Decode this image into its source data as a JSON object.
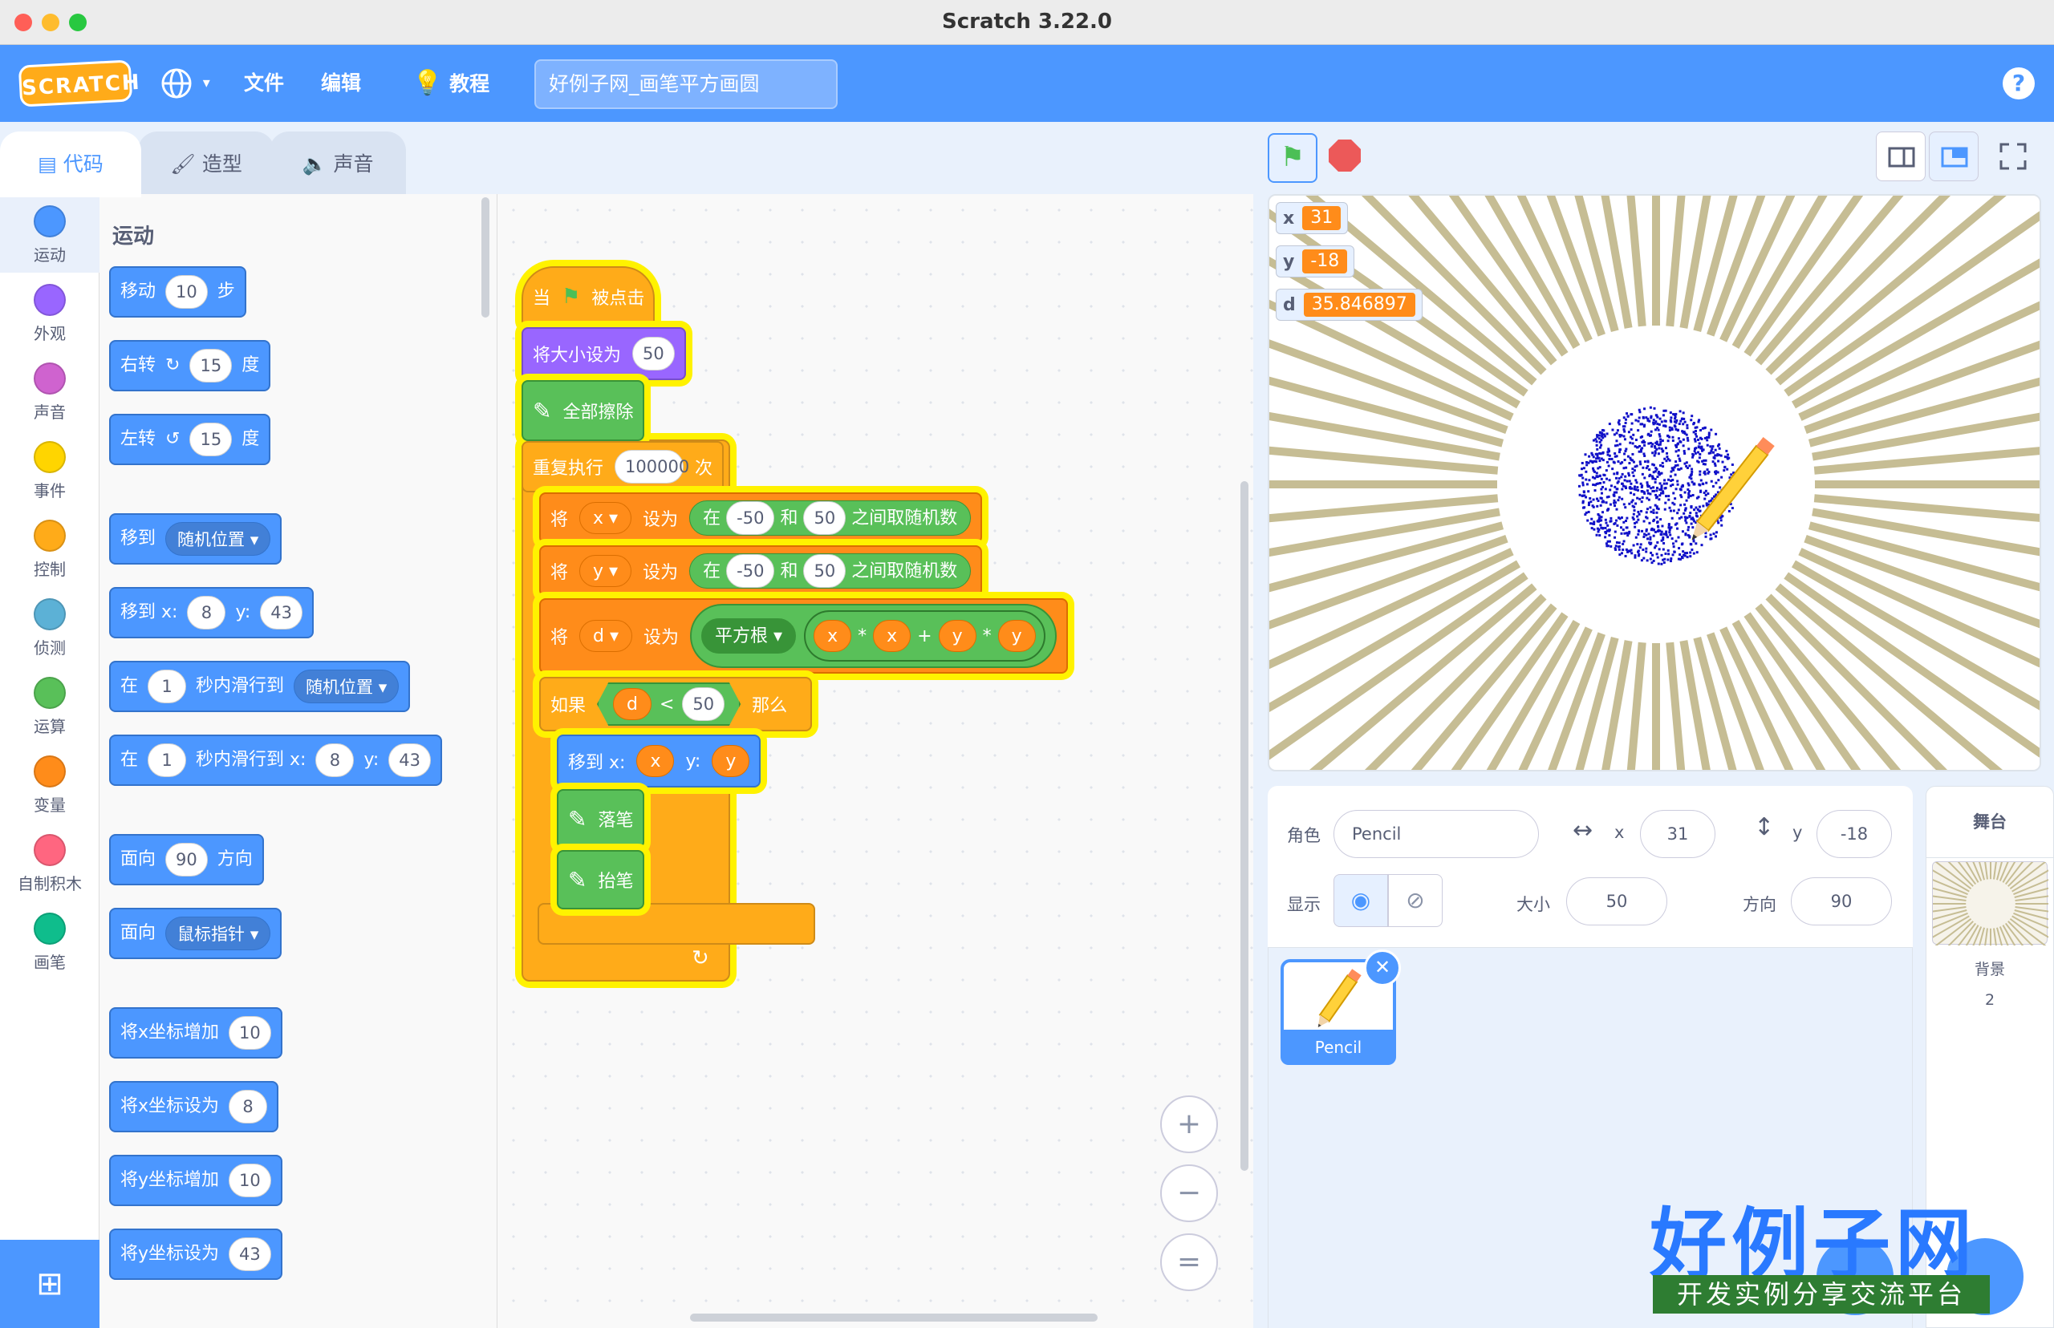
{
  "window": {
    "title": "Scratch 3.22.0"
  },
  "menubar": {
    "logo": "SCRATCH",
    "file": "文件",
    "edit": "编辑",
    "tutorials": "教程",
    "project_title": "好例子网_画笔平方画圆",
    "help": "?"
  },
  "tabs": {
    "code": "代码",
    "costumes": "造型",
    "sounds": "声音"
  },
  "categories": [
    {
      "label": "运动",
      "color": "#4c97ff"
    },
    {
      "label": "外观",
      "color": "#9966ff"
    },
    {
      "label": "声音",
      "color": "#cf63cf"
    },
    {
      "label": "事件",
      "color": "#ffd500"
    },
    {
      "label": "控制",
      "color": "#ffab19"
    },
    {
      "label": "侦测",
      "color": "#5cb1d6"
    },
    {
      "label": "运算",
      "color": "#59c059"
    },
    {
      "label": "变量",
      "color": "#ff8c1a"
    },
    {
      "label": "自制积木",
      "color": "#ff6680"
    },
    {
      "label": "画笔",
      "color": "#0fbd8c"
    }
  ],
  "palette": {
    "heading": "运动",
    "move": {
      "a": "移动",
      "v": "10",
      "b": "步"
    },
    "turn_right": {
      "a": "右转",
      "v": "15",
      "b": "度"
    },
    "turn_left": {
      "a": "左转",
      "v": "15",
      "b": "度"
    },
    "goto": {
      "a": "移到",
      "dd": "随机位置"
    },
    "goto_xy": {
      "a": "移到 x:",
      "x": "8",
      "b": "y:",
      "y": "43"
    },
    "glide_to": {
      "a": "在",
      "v": "1",
      "b": "秒内滑行到",
      "dd": "随机位置"
    },
    "glide_xy": {
      "a": "在",
      "v": "1",
      "b": "秒内滑行到 x:",
      "x": "8",
      "c": "y:",
      "y": "43"
    },
    "point_dir": {
      "a": "面向",
      "v": "90",
      "b": "方向"
    },
    "point_towards": {
      "a": "面向",
      "dd": "鼠标指针"
    },
    "change_x": {
      "a": "将x坐标增加",
      "v": "10"
    },
    "set_x": {
      "a": "将x坐标设为",
      "v": "8"
    },
    "change_y": {
      "a": "将y坐标增加",
      "v": "10"
    },
    "set_y": {
      "a": "将y坐标设为",
      "v": "43"
    }
  },
  "script": {
    "when_flag": {
      "a": "当",
      "b": "被点击"
    },
    "set_size": {
      "a": "将大小设为",
      "v": "50"
    },
    "clear": "全部擦除",
    "repeat": {
      "a": "重复执行",
      "v": "100000",
      "b": "次"
    },
    "set_x": {
      "a": "将",
      "var": "x",
      "b": "设为",
      "c": "在",
      "lo": "-50",
      "d": "和",
      "hi": "50",
      "e": "之间取随机数"
    },
    "set_y": {
      "a": "将",
      "var": "y",
      "b": "设为",
      "c": "在",
      "lo": "-50",
      "d": "和",
      "hi": "50",
      "e": "之间取随机数"
    },
    "set_d": {
      "a": "将",
      "var": "d",
      "b": "设为",
      "fn": "平方根",
      "x1": "x",
      "m1": "*",
      "x2": "x",
      "plus": "+",
      "y1": "y",
      "m2": "*",
      "y2": "y"
    },
    "if": {
      "a": "如果",
      "d": "d",
      "lt": "<",
      "v": "50",
      "b": "那么"
    },
    "goto": {
      "a": "移到 x:",
      "x": "x",
      "b": "y:",
      "y": "y"
    },
    "pen_down": "落笔",
    "pen_up": "抬笔",
    "loop_arrow": "↻"
  },
  "zoom": {
    "in": "+",
    "out": "−",
    "reset": "="
  },
  "monitors": [
    {
      "name": "x",
      "value": "31"
    },
    {
      "name": "y",
      "value": "-18"
    },
    {
      "name": "d",
      "value": "35.846897"
    }
  ],
  "sprite_info": {
    "sprite_label": "角色",
    "sprite_name": "Pencil",
    "x_label": "x",
    "x": "31",
    "y_label": "y",
    "y": "-18",
    "show_label": "显示",
    "size_label": "大小",
    "size": "50",
    "direction_label": "方向",
    "direction": "90"
  },
  "sprite_list": [
    {
      "name": "Pencil"
    }
  ],
  "stage_pane": {
    "title": "舞台",
    "backdrops_label": "背景",
    "backdrops_count": "2"
  },
  "watermark": {
    "big": "好例子网",
    "small": "开发实例分享交流平台"
  },
  "colors": {
    "accent": "#4c97ff",
    "control": "#ffab19",
    "operator": "#59c059",
    "variable": "#ff8c1a",
    "looks": "#9966ff",
    "highlight": "#fff200"
  }
}
